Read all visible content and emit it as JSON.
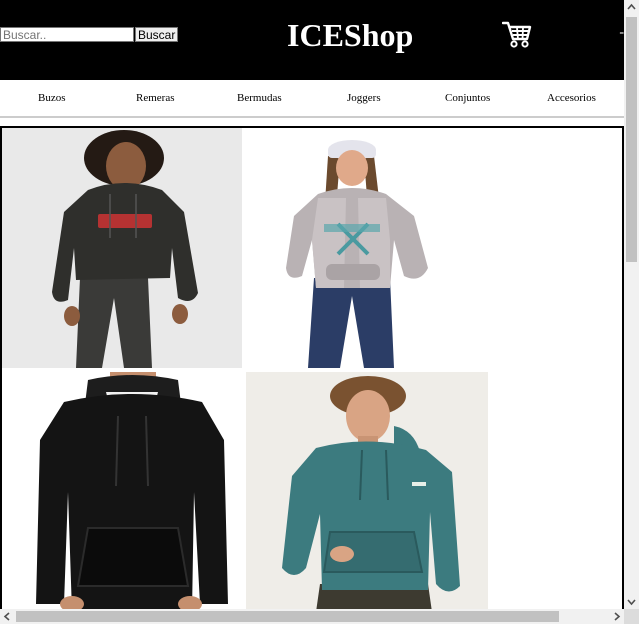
{
  "search": {
    "placeholder": "Buscar..",
    "button_label": "Buscar"
  },
  "brand": {
    "name": "ICEShop"
  },
  "header_icons": {
    "cart": "shopping-cart-icon",
    "edge": "-"
  },
  "nav": {
    "items": [
      {
        "label": "Buzos"
      },
      {
        "label": "Remeras"
      },
      {
        "label": "Bermudas"
      },
      {
        "label": "Joggers"
      },
      {
        "label": "Conjuntos"
      },
      {
        "label": "Accesorios"
      }
    ]
  },
  "products": [
    {
      "image": "woman-black-logo-hoodie-photo",
      "hoodie_color": "#2f2f2c",
      "background": "#e9e9e9"
    },
    {
      "image": "girl-grey-raglan-hoodie-photo",
      "hoodie_color": "#b9b2b4",
      "background": "#ffffff"
    },
    {
      "image": "black-hoodie-photo",
      "hoodie_color": "#141414",
      "background": "#ffffff"
    },
    {
      "image": "man-teal-hoodie-photo",
      "hoodie_color": "#3c7b7f",
      "background": "#efede8"
    }
  ],
  "colors": {
    "header_bg": "#000000",
    "brand_text": "#ffffff",
    "nav_border": "#cccccc"
  }
}
